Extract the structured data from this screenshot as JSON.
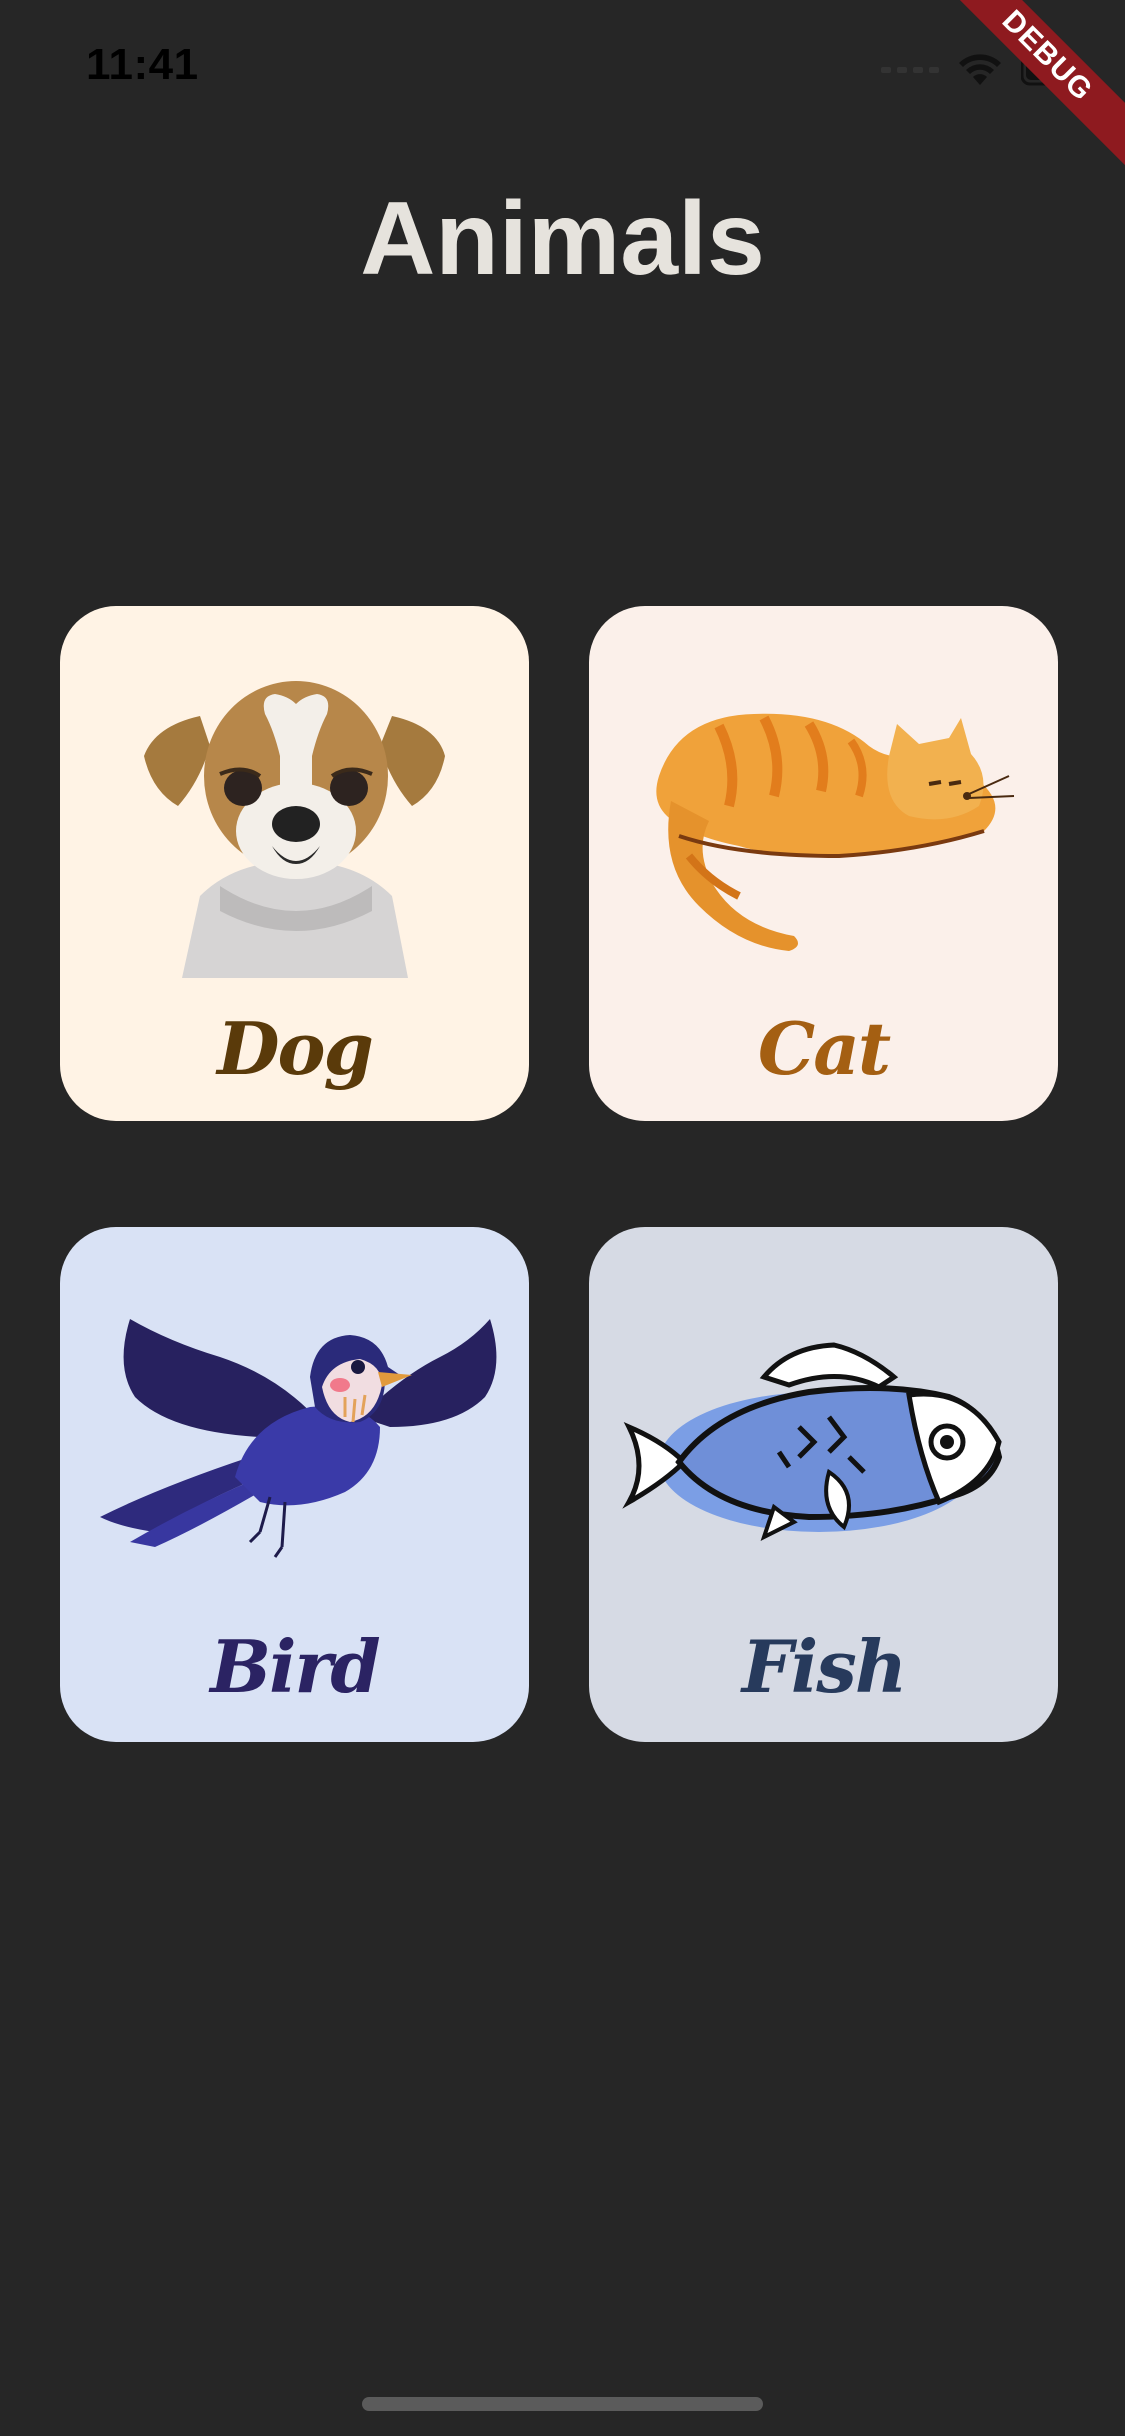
{
  "status_bar": {
    "time": "11:41"
  },
  "debug_banner": {
    "text": "DEBUG"
  },
  "header": {
    "title": "Animals"
  },
  "cards": [
    {
      "label": "Dog",
      "icon": "dog-icon",
      "color": "#fff3e5"
    },
    {
      "label": "Cat",
      "icon": "cat-icon",
      "color": "#fbf0ea"
    },
    {
      "label": "Bird",
      "icon": "bird-icon",
      "color": "#d9e2f5"
    },
    {
      "label": "Fish",
      "icon": "fish-icon",
      "color": "#d6dae4"
    }
  ],
  "colors": {
    "background": "#262626",
    "title": "#e6e3dd",
    "debug": "#8e1a1f"
  }
}
